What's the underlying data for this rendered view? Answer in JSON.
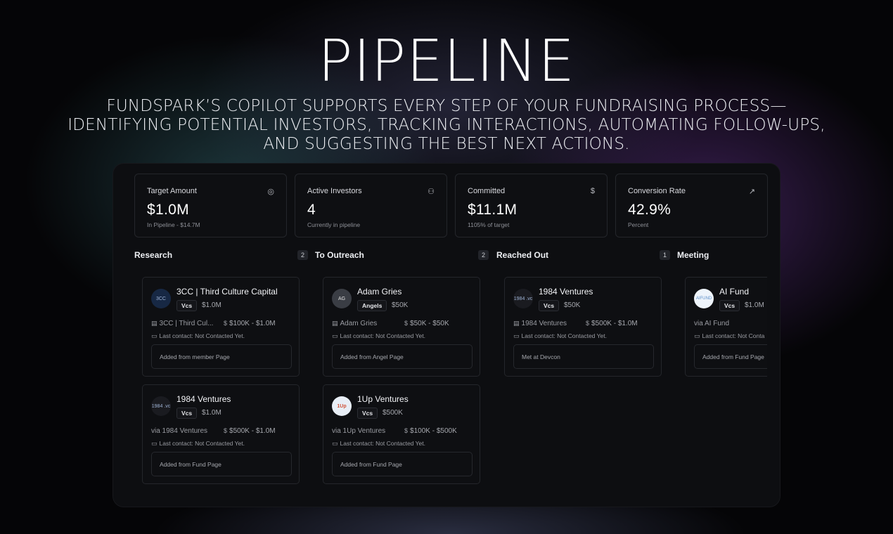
{
  "hero": {
    "title": "PIPELINE",
    "subtitle_line1": "FUNDSPARK’S COPILOT SUPPORTS EVERY STEP OF YOUR FUNDRAISING PROCESS—",
    "subtitle_line2": "IDENTIFYING POTENTIAL INVESTORS, TRACKING INTERACTIONS, AUTOMATING FOLLOW-UPS,",
    "subtitle_line3": "AND SUGGESTING THE BEST NEXT ACTIONS."
  },
  "stats": [
    {
      "label": "Target Amount",
      "value": "$1.0M",
      "sub": "In Pipeline - $14.7M",
      "icon": "target-icon",
      "glyph": "◎"
    },
    {
      "label": "Active Investors",
      "value": "4",
      "sub": "Currently in pipeline",
      "icon": "users-icon",
      "glyph": "⚇"
    },
    {
      "label": "Committed",
      "value": "$11.1M",
      "sub": "1105% of target",
      "icon": "dollar-icon",
      "glyph": "$"
    },
    {
      "label": "Conversion Rate",
      "value": "42.9%",
      "sub": "Percent",
      "icon": "trending-up-icon",
      "glyph": "↗"
    }
  ],
  "columns": [
    {
      "title": "Research",
      "count": "2",
      "cards": [
        {
          "avatar": "3CC",
          "name": "3CC | Third Culture Capital",
          "badge": "Vcs",
          "amount": "$1.0M",
          "via": "3CC | Third Cul...",
          "range": "$100K - $1.0M",
          "contact": "Last contact: Not Contacted Yet.",
          "note": "Added from member Page"
        },
        {
          "avatar": "1984 .vc",
          "name": "1984 Ventures",
          "badge": "Vcs",
          "amount": "$1.0M",
          "via": "via 1984 Ventures",
          "range": "$500K - $1.0M",
          "contact": "Last contact: Not Contacted Yet.",
          "note": "Added from Fund Page"
        }
      ]
    },
    {
      "title": "To Outreach",
      "count": "2",
      "cards": [
        {
          "avatar": "AG",
          "name": "Adam Gries",
          "badge": "Angels",
          "amount": "$50K",
          "via": "Adam Gries",
          "range": "$50K - $50K",
          "contact": "Last contact: Not Contacted Yet.",
          "note": "Added from Angel Page"
        },
        {
          "avatar": "1Up",
          "name": "1Up Ventures",
          "badge": "Vcs",
          "amount": "$500K",
          "via": "via 1Up Ventures",
          "range": "$100K - $500K",
          "contact": "Last contact: Not Contacted Yet.",
          "note": "Added from Fund Page"
        }
      ]
    },
    {
      "title": "Reached Out",
      "count": "1",
      "cards": [
        {
          "avatar": "1984 .vc",
          "name": "1984 Ventures",
          "badge": "Vcs",
          "amount": "$50K",
          "via": "1984 Ventures",
          "range": "$500K - $1.0M",
          "contact": "Last contact: Not Contacted Yet.",
          "note": "Met at Devcon"
        }
      ]
    },
    {
      "title": "Meeting",
      "count": "",
      "cards": [
        {
          "avatar": "AIFUND",
          "name": "AI Fund",
          "badge": "Vcs",
          "amount": "$1.0M",
          "via": "via AI Fund",
          "range": "",
          "contact": "Last contact: Not Conta",
          "note": "Added from Fund Page"
        }
      ]
    }
  ]
}
